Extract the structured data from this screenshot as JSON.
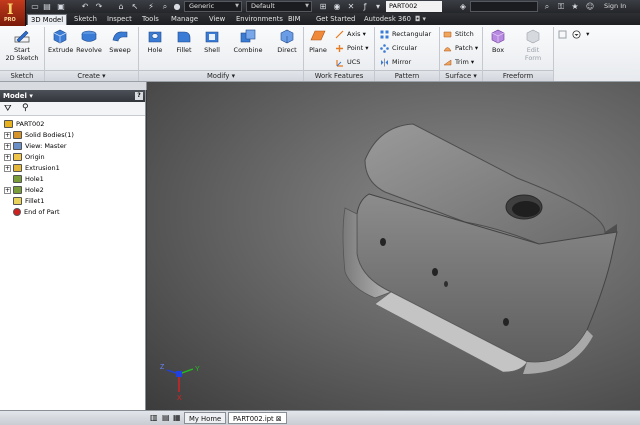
{
  "app": {
    "logo_letter": "I",
    "edition": "PRO"
  },
  "quick_access": {
    "material_combo": "Generic",
    "appearance_combo": "Default",
    "document_title": "PART002",
    "sign_in": "Sign In"
  },
  "tabs": [
    {
      "label": "3D Model",
      "active": true
    },
    {
      "label": "Sketch"
    },
    {
      "label": "Inspect"
    },
    {
      "label": "Tools"
    },
    {
      "label": "Manage"
    },
    {
      "label": "View"
    },
    {
      "label": "Environments"
    },
    {
      "label": "BIM"
    },
    {
      "label": "Get Started"
    },
    {
      "label": "Autodesk 360"
    }
  ],
  "ribbon": {
    "sketch": {
      "start_line1": "Start",
      "start_line2": "2D Sketch",
      "panel": "Sketch"
    },
    "create": {
      "extrude": "Extrude",
      "revolve": "Revolve",
      "sweep": "Sweep",
      "panel": "Create"
    },
    "modify": {
      "hole": "Hole",
      "fillet": "Fillet",
      "shell": "Shell",
      "combine": "Combine",
      "direct": "Direct",
      "panel": "Modify"
    },
    "work_features": {
      "plane": "Plane",
      "axis": "Axis",
      "point": "Point",
      "ucs": "UCS",
      "panel": "Work Features"
    },
    "pattern": {
      "rectangular": "Rectangular",
      "circular": "Circular",
      "mirror": "Mirror",
      "panel": "Pattern"
    },
    "surface": {
      "stitch": "Stitch",
      "patch": "Patch",
      "trim": "Trim",
      "panel": "Surface"
    },
    "freeform": {
      "box": "Box",
      "edit_line1": "Edit",
      "edit_line2": "Form",
      "panel": "Freeform"
    }
  },
  "browser": {
    "title": "Model",
    "tree": [
      {
        "label": "PART002",
        "icon": "part-icon",
        "color": "#e8b21f",
        "depth": 0,
        "expander": ""
      },
      {
        "label": "Solid Bodies(1)",
        "icon": "solid-bodies-icon",
        "color": "#d6932a",
        "depth": 1,
        "expander": "+"
      },
      {
        "label": "View: Master",
        "icon": "view-icon",
        "color": "#6b8fc7",
        "depth": 1,
        "expander": "+"
      },
      {
        "label": "Origin",
        "icon": "folder-icon",
        "color": "#f0c54a",
        "depth": 1,
        "expander": "+"
      },
      {
        "label": "Extrusion1",
        "icon": "extrusion-icon",
        "color": "#e3b83a",
        "depth": 1,
        "expander": "+"
      },
      {
        "label": "Hole1",
        "icon": "hole-icon",
        "color": "#7a9d3a",
        "depth": 1,
        "expander": ""
      },
      {
        "label": "Hole2",
        "icon": "hole-icon",
        "color": "#7a9d3a",
        "depth": 1,
        "expander": "+"
      },
      {
        "label": "Fillet1",
        "icon": "fillet-icon",
        "color": "#e8d25a",
        "depth": 1,
        "expander": ""
      },
      {
        "label": "End of Part",
        "icon": "end-of-part-icon",
        "color": "#d02020",
        "depth": 1,
        "expander": ""
      }
    ]
  },
  "statusbar": {
    "home_tab": "My Home",
    "doc_tab": "PART002.ipt"
  },
  "triad": {
    "x": "X",
    "y": "Y",
    "z": "Z"
  }
}
